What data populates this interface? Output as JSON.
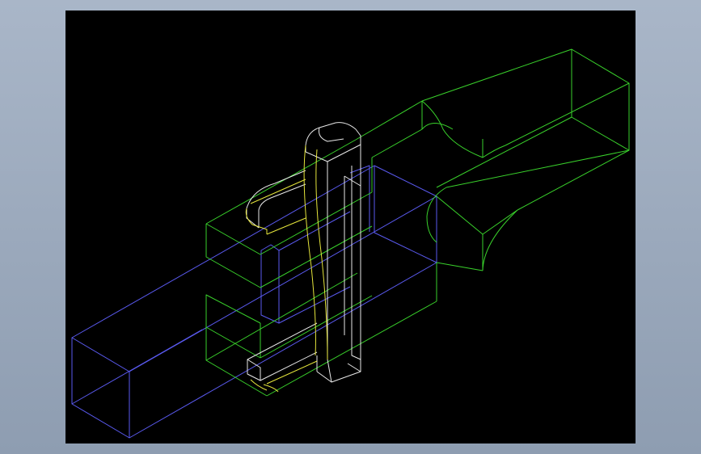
{
  "background": {
    "gradient_top": "#a9b6c8",
    "gradient_bottom": "#8e9db1"
  },
  "viewport": {
    "background_color": "#000000"
  },
  "wireframe": {
    "colors": {
      "outer_body": "#39d12b",
      "inner_bar": "#5a5af0",
      "clip_frame": "#e8e8e8",
      "clip_edge": "#e6e63c"
    }
  }
}
